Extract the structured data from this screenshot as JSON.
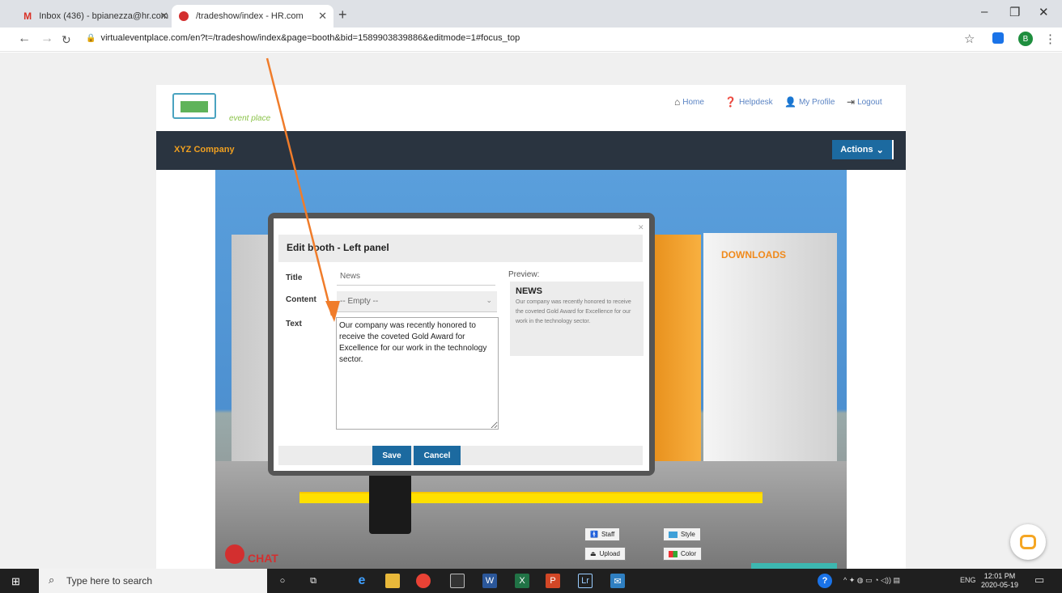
{
  "browser": {
    "tabs": [
      {
        "label": "Inbox (436) - bpianezza@hr.com",
        "icon": "gmail-icon",
        "active": false
      },
      {
        "label": "/tradeshow/index - HR.com",
        "icon": "site-favicon-red",
        "active": true
      }
    ],
    "new_tab": "+",
    "url": "virtualeventplace.com/en?t=/tradeshow/index&page=booth&bid=1589903839886&editmode=1#focus_top",
    "profile_initial": "B",
    "colors": {
      "tabstrip": "#dee1e6",
      "profile": "#1e8e3e"
    }
  },
  "site": {
    "logo_text": "event place",
    "nav": {
      "home": "Home",
      "helpdesk": "Helpdesk",
      "profile": "My Profile",
      "logout": "Logout"
    },
    "company": "XYZ Company",
    "actions_label": "Actions",
    "booth": {
      "downloads": "DOWNLOADS",
      "chat": "CHAT",
      "staff": "Staff",
      "style": "Style",
      "upload": "Upload",
      "color": "Color"
    },
    "colors": {
      "accent": "#1c6aa0",
      "company": "#f0a020",
      "darkbar": "#2a3440",
      "booth_orange": "#f08a1c"
    }
  },
  "modal": {
    "title": "Edit booth - Left panel",
    "labels": {
      "title": "Title",
      "content": "Content",
      "text": "Text",
      "preview": "Preview:"
    },
    "title_value": "News",
    "content_value": "-- Empty --",
    "text_value": "Our company was recently honored to receive the coveted Gold Award for Excellence for our work in the technology sector.",
    "preview": {
      "heading": "NEWS",
      "body": "Our company was recently honored to receive the coveted Gold Award for Excellence for our work in the technology sector."
    },
    "save_label": "Save",
    "cancel_label": "Cancel"
  },
  "taskbar": {
    "search_placeholder": "Type here to search",
    "lang": "ENG",
    "time": "12:01 PM",
    "date": "2020-05-19"
  }
}
